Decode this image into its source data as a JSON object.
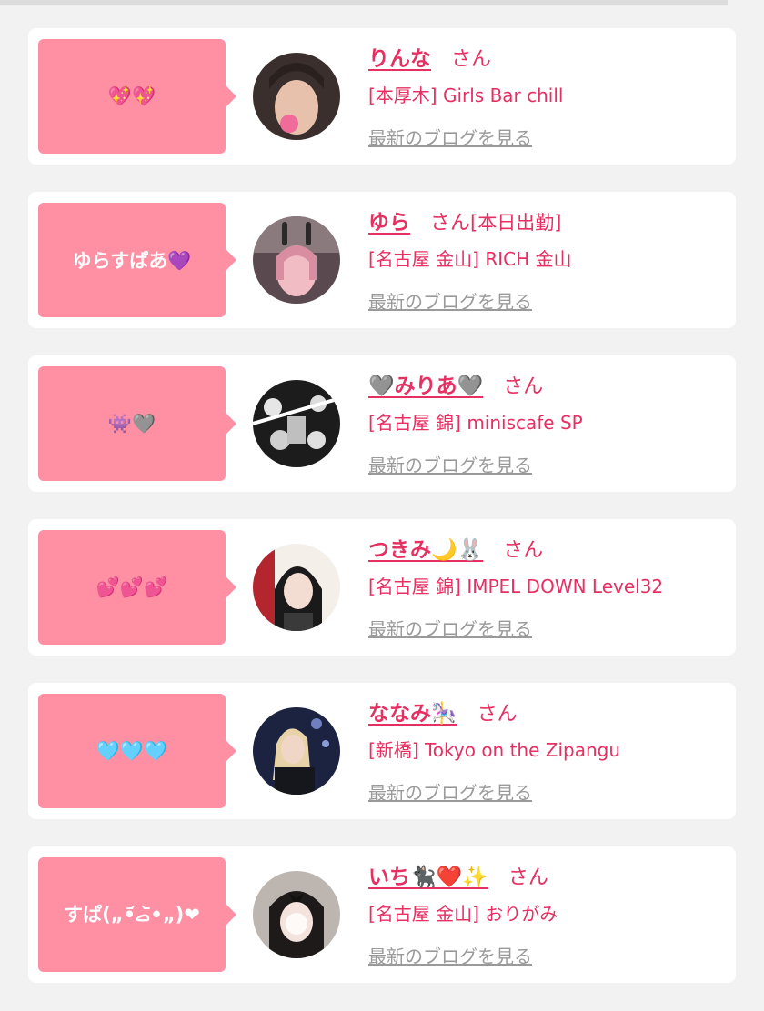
{
  "suffix": "さん",
  "blog_link": "最新のブログを見る",
  "colors": {
    "bubble": "#ff8fa3",
    "accent": "#e63062",
    "muted": "#9a9a9a",
    "background": "#f2f2f2"
  },
  "cards": [
    {
      "message": "💖💖",
      "name": "りんな",
      "tag": "",
      "shop": "[本厚木] Girls Bar chill",
      "avatar_icon": "girl-photo-avatar"
    },
    {
      "message": "ゆらすぱあ💜",
      "name": "ゆら",
      "tag": "[本日出勤]",
      "shop": "[名古屋 金山] RICH 金山",
      "avatar_icon": "girl-photo-avatar"
    },
    {
      "message": "👾🩶",
      "name": "🩶みりあ🩶",
      "tag": "",
      "shop": "[名古屋 錦] miniscafe SP",
      "avatar_icon": "girl-photo-avatar"
    },
    {
      "message": "💕💕💕",
      "name": "つきみ🌙🐰",
      "tag": "",
      "shop": "[名古屋 錦] IMPEL DOWN Level32",
      "avatar_icon": "girl-photo-avatar"
    },
    {
      "message": "🩵🩵🩵",
      "name": "ななみ🎠",
      "tag": "",
      "shop": "[新橋] Tokyo on the Zipangu",
      "avatar_icon": "girl-photo-avatar"
    },
    {
      "message": "すぱ(„•᷄ࡇ•᷅„)❤",
      "name": "いち🐈‍⬛❤️✨",
      "tag": "",
      "shop": "[名古屋 金山] おりがみ",
      "avatar_icon": "girl-photo-avatar"
    }
  ]
}
